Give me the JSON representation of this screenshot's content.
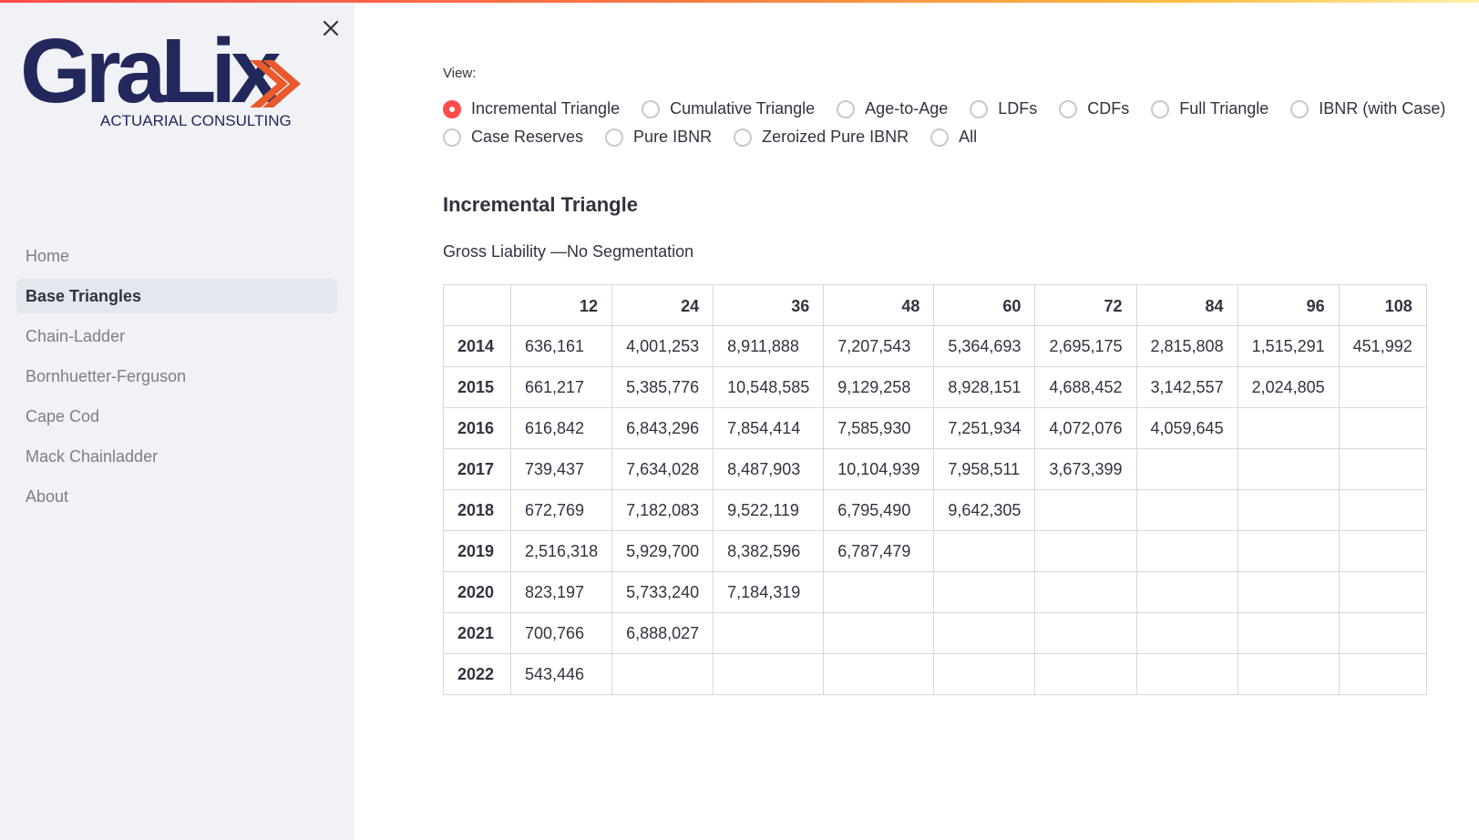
{
  "sidebar": {
    "logo": {
      "brand": "GraLix",
      "tagline": "ACTUARIAL CONSULTING",
      "brand_color": "#22285c",
      "accent_color": "#e8592b"
    },
    "close_icon": "close-icon",
    "items": [
      {
        "label": "Home",
        "active": false
      },
      {
        "label": "Base Triangles",
        "active": true
      },
      {
        "label": "Chain-Ladder",
        "active": false
      },
      {
        "label": "Bornhuetter-Ferguson",
        "active": false
      },
      {
        "label": "Cape Cod",
        "active": false
      },
      {
        "label": "Mack Chainladder",
        "active": false
      },
      {
        "label": "About",
        "active": false
      }
    ]
  },
  "view": {
    "label": "View:",
    "options_row1": [
      "Incremental Triangle",
      "Cumulative Triangle",
      "Age-to-Age",
      "LDFs",
      "CDFs",
      "Full Triangle",
      "IBNR (with Case)"
    ],
    "options_row2": [
      "Case Reserves",
      "Pure IBNR",
      "Zeroized Pure IBNR",
      "All"
    ],
    "selected": "Incremental Triangle"
  },
  "section": {
    "title": "Incremental Triangle",
    "subtitle": "Gross Liability —No Segmentation"
  },
  "table": {
    "columns": [
      "12",
      "24",
      "36",
      "48",
      "60",
      "72",
      "84",
      "96",
      "108"
    ],
    "rows": [
      {
        "year": "2014",
        "values": [
          "636,161",
          "4,001,253",
          "8,911,888",
          "7,207,543",
          "5,364,693",
          "2,695,175",
          "2,815,808",
          "1,515,291",
          "451,992"
        ]
      },
      {
        "year": "2015",
        "values": [
          "661,217",
          "5,385,776",
          "10,548,585",
          "9,129,258",
          "8,928,151",
          "4,688,452",
          "3,142,557",
          "2,024,805",
          ""
        ]
      },
      {
        "year": "2016",
        "values": [
          "616,842",
          "6,843,296",
          "7,854,414",
          "7,585,930",
          "7,251,934",
          "4,072,076",
          "4,059,645",
          "",
          ""
        ]
      },
      {
        "year": "2017",
        "values": [
          "739,437",
          "7,634,028",
          "8,487,903",
          "10,104,939",
          "7,958,511",
          "3,673,399",
          "",
          "",
          ""
        ]
      },
      {
        "year": "2018",
        "values": [
          "672,769",
          "7,182,083",
          "9,522,119",
          "6,795,490",
          "9,642,305",
          "",
          "",
          "",
          ""
        ]
      },
      {
        "year": "2019",
        "values": [
          "2,516,318",
          "5,929,700",
          "8,382,596",
          "6,787,479",
          "",
          "",
          "",
          "",
          ""
        ]
      },
      {
        "year": "2020",
        "values": [
          "823,197",
          "5,733,240",
          "7,184,319",
          "",
          "",
          "",
          "",
          "",
          ""
        ]
      },
      {
        "year": "2021",
        "values": [
          "700,766",
          "6,888,027",
          "",
          "",
          "",
          "",
          "",
          "",
          ""
        ]
      },
      {
        "year": "2022",
        "values": [
          "543,446",
          "",
          "",
          "",
          "",
          "",
          "",
          "",
          ""
        ]
      }
    ]
  },
  "colors": {
    "accent": "#ff4b4b",
    "sidebar_bg": "#f0f2f6",
    "active_item_bg": "#e5e7ee",
    "text": "#31333f",
    "muted_text": "#7c7f88"
  }
}
